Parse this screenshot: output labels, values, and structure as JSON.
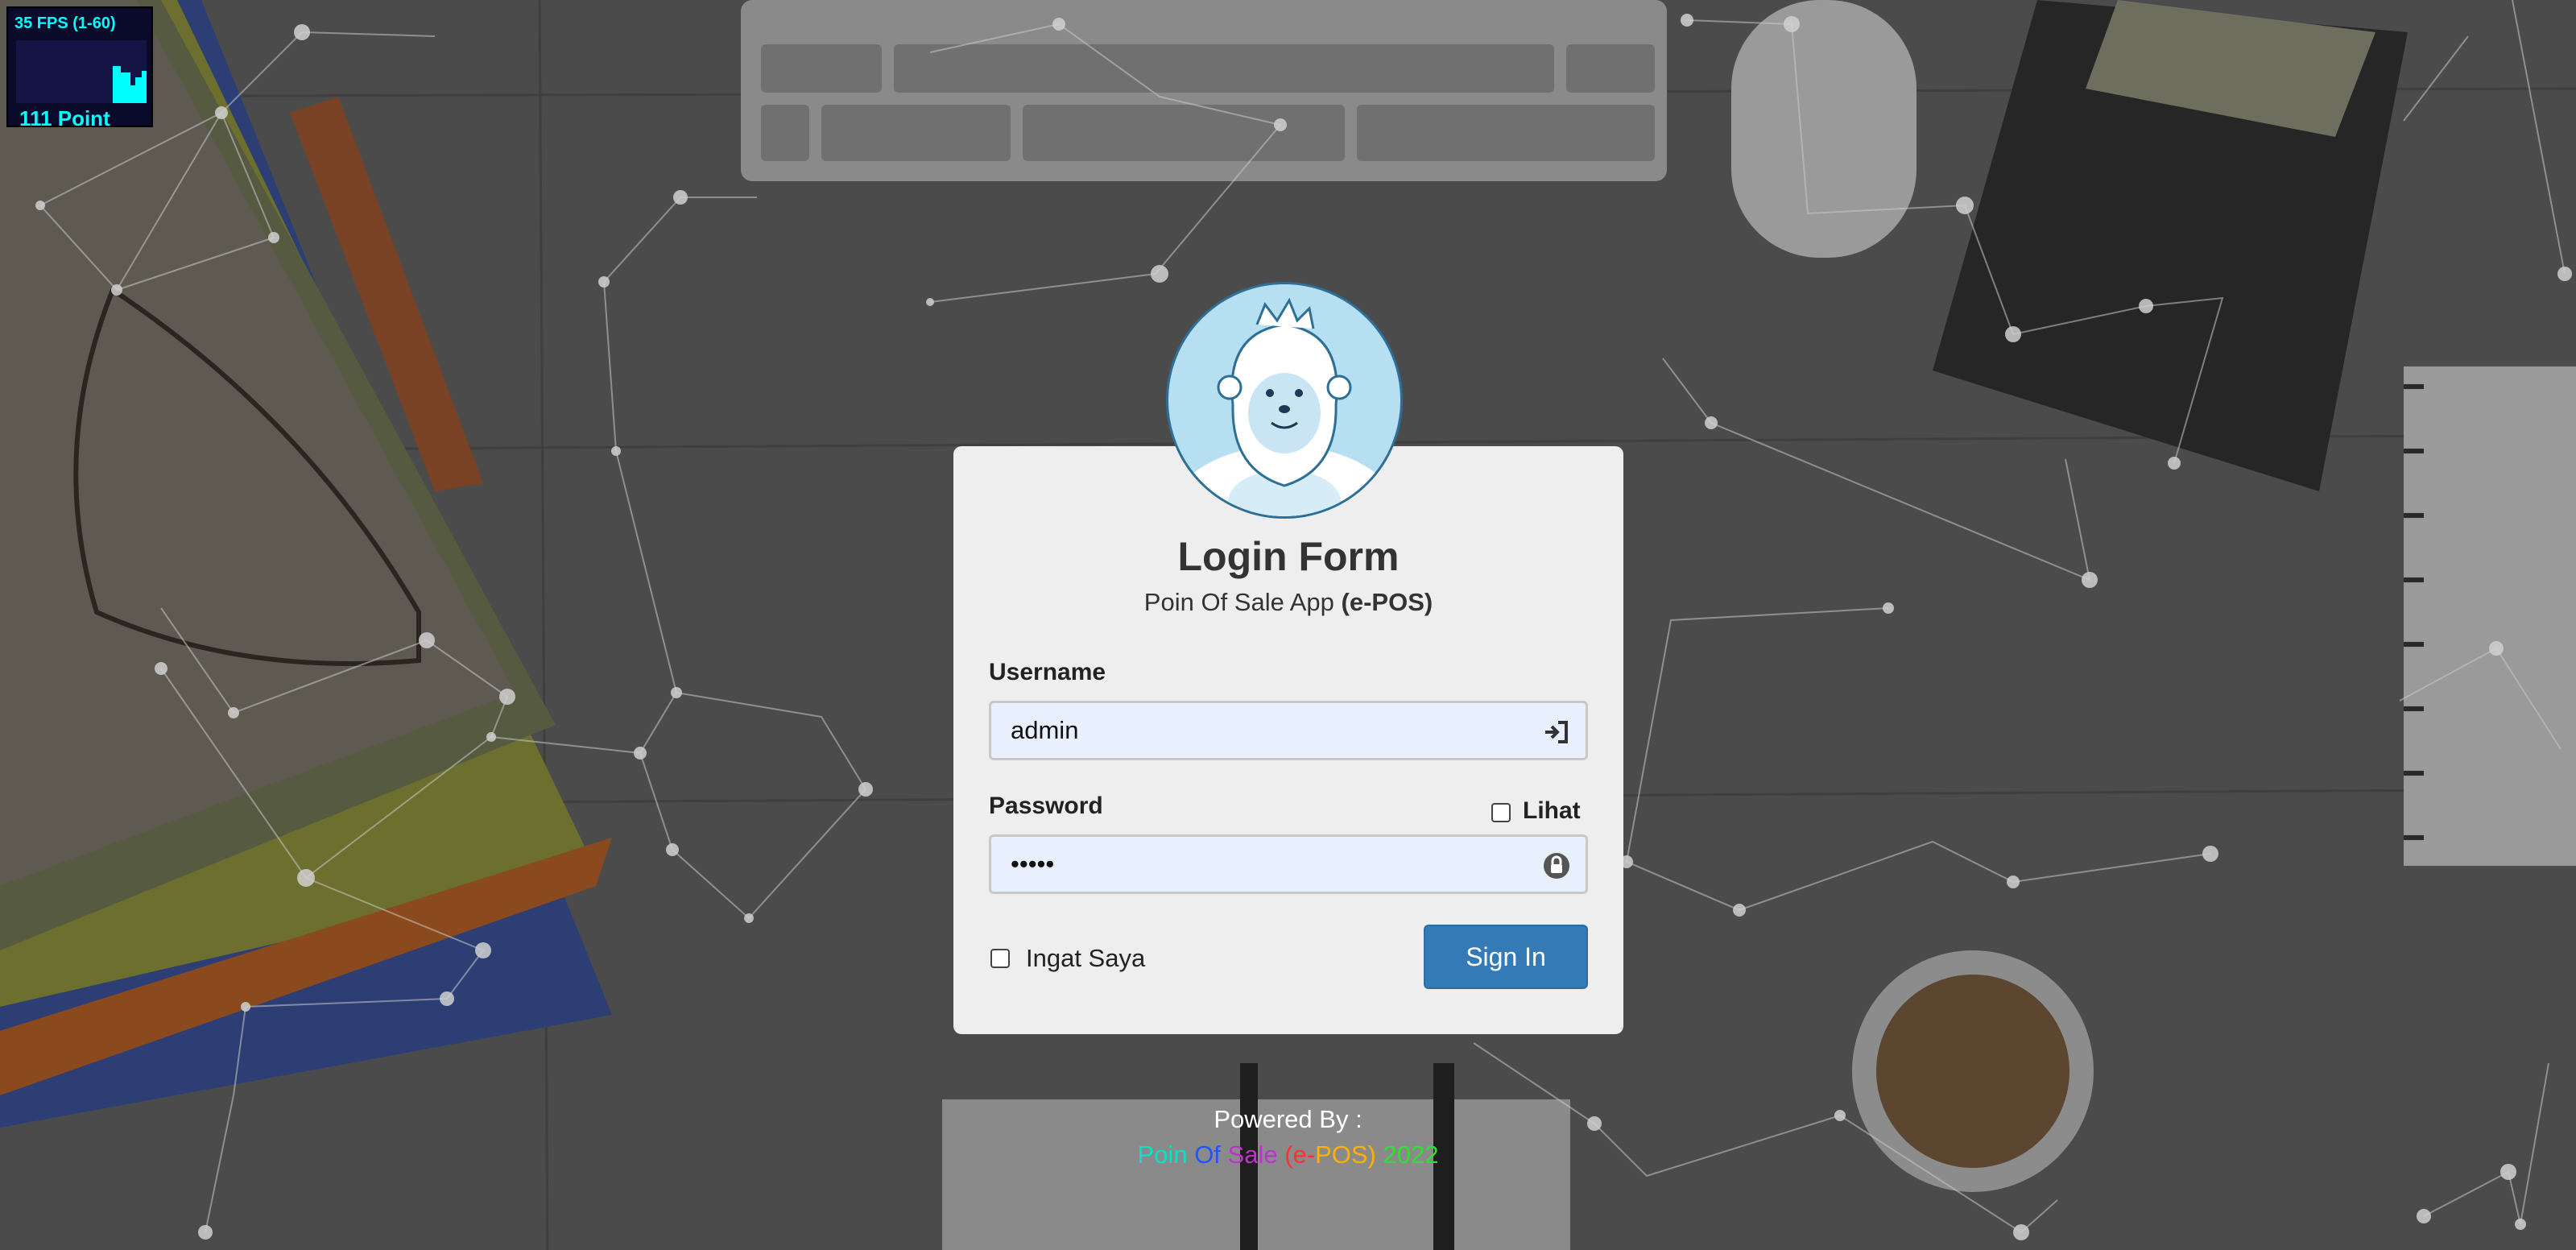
{
  "fps_meter": {
    "fps_text": "35 FPS (1-60)",
    "points_text": "111 Point"
  },
  "avatar": {
    "icon": "yeti-mascot-icon"
  },
  "login": {
    "title": "Login Form",
    "subtitle_prefix": "Poin Of Sale App ",
    "subtitle_bold": "(e-POS)",
    "username_label": "Username",
    "username_value": "admin",
    "username_icon": "sign-in-icon",
    "password_label": "Password",
    "show_password_label": "Lihat",
    "password_value": "•••••",
    "password_icon": "lock-icon",
    "remember_label": "Ingat Saya",
    "sign_in_label": "Sign In"
  },
  "footer": {
    "powered_by": "Powered By :",
    "brand_parts": [
      {
        "text": "Poin ",
        "color": "#00e5c8"
      },
      {
        "text": "Of ",
        "color": "#2255ff"
      },
      {
        "text": "Sale ",
        "color": "#c030d0"
      },
      {
        "text": "(e-",
        "color": "#ff3030"
      },
      {
        "text": "POS) ",
        "color": "#ffb000"
      },
      {
        "text": "2022",
        "color": "#30e030"
      }
    ]
  },
  "colors": {
    "accent": "#337ab7",
    "card": "#eeeeee",
    "fps": "#00ffff"
  }
}
